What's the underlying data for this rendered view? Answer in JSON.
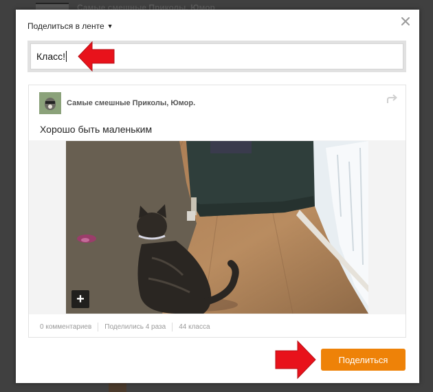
{
  "background": {
    "feed_title": "Самые смешные Приколы, Юмор"
  },
  "modal": {
    "header_label": "Поделиться в ленте",
    "header_caret": "▼",
    "close_glyph": "✕",
    "comment_value": "Класс!",
    "submit_label": "Поделиться"
  },
  "post": {
    "group_name": "Самые смешные Приколы, Юмор.",
    "text": "Хорошо быть маленьким",
    "add_glyph": "+",
    "comments": "0 комментариев",
    "shares": "Поделились 4 раза",
    "likes": "44 класса"
  },
  "colors": {
    "accent_orange": "#ee8208",
    "annotation_red": "#e8121b"
  },
  "icons": {
    "caret": "caret-down-icon",
    "close": "close-icon",
    "reshare": "reshare-arrow-icon",
    "add": "plus-icon",
    "annotation": "red-arrow-icon"
  }
}
